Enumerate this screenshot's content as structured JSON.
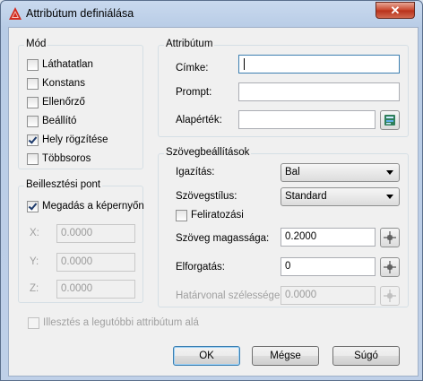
{
  "window": {
    "title": "Attribútum definiálása",
    "close": "✕"
  },
  "mode": {
    "title": "Mód",
    "items": [
      {
        "label": "Láthatatlan",
        "checked": false
      },
      {
        "label": "Konstans",
        "checked": false
      },
      {
        "label": "Ellenőrző",
        "checked": false
      },
      {
        "label": "Beállító",
        "checked": false
      },
      {
        "label": "Hely rögzítése",
        "checked": true
      },
      {
        "label": "Többsoros",
        "checked": false
      }
    ]
  },
  "insertion": {
    "title": "Beillesztési pont",
    "specify_on_screen": {
      "label": "Megadás a képernyőn",
      "checked": true
    },
    "x": {
      "label": "X:",
      "value": "0.0000"
    },
    "y": {
      "label": "Y:",
      "value": "0.0000"
    },
    "z": {
      "label": "Z:",
      "value": "0.0000"
    }
  },
  "attribute": {
    "title": "Attribútum",
    "tag": {
      "label": "Címke:",
      "value": ""
    },
    "prompt": {
      "label": "Prompt:",
      "value": ""
    },
    "default": {
      "label": "Alapérték:",
      "value": ""
    }
  },
  "text_settings": {
    "title": "Szövegbeállítások",
    "justification": {
      "label": "Igazítás:",
      "value": "Bal"
    },
    "text_style": {
      "label": "Szövegstílus:",
      "value": "Standard"
    },
    "annotative": {
      "label": "Feliratozási",
      "checked": false
    },
    "text_height": {
      "label": "Szöveg magassága:",
      "value": "0.2000"
    },
    "rotation": {
      "label": "Elforgatás:",
      "value": "0"
    },
    "boundary_width": {
      "label": "Határvonal szélessége:",
      "value": "0.0000"
    }
  },
  "align_below": {
    "label": "Illesztés a legutóbbi attribútum alá",
    "checked": false
  },
  "buttons": {
    "ok": "OK",
    "cancel": "Mégse",
    "help": "Súgó"
  }
}
